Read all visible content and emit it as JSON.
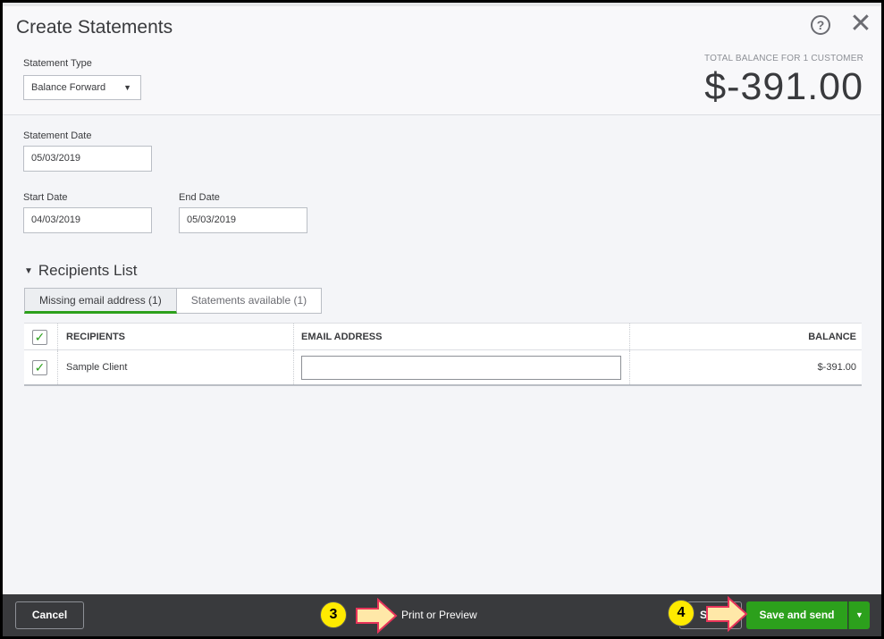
{
  "dialog": {
    "title": "Create Statements"
  },
  "statement_type": {
    "label": "Statement Type",
    "selected": "Balance Forward"
  },
  "total": {
    "label": "TOTAL BALANCE FOR 1 CUSTOMER",
    "value": "$-391.00"
  },
  "statement_date": {
    "label": "Statement Date",
    "value": "05/03/2019"
  },
  "start_date": {
    "label": "Start Date",
    "value": "04/03/2019"
  },
  "end_date": {
    "label": "End Date",
    "value": "05/03/2019"
  },
  "recipients": {
    "section_title": "Recipients List",
    "tabs": [
      {
        "label": "Missing email address (1)",
        "active": true
      },
      {
        "label": "Statements available (1)",
        "active": false
      }
    ],
    "columns": [
      "RECIPIENTS",
      "EMAIL ADDRESS",
      "BALANCE"
    ],
    "rows": [
      {
        "name": "Sample Client",
        "email": "",
        "balance": "$-391.00",
        "checked": true
      }
    ]
  },
  "footer": {
    "cancel_label": "Cancel",
    "print_label": "Print or Preview",
    "save_label": "Save",
    "save_send_label": "Save and send"
  },
  "annotations": {
    "step3": "3",
    "step4": "4"
  },
  "colors": {
    "accent_green": "#2ca01c",
    "footer_bg": "#393a3d",
    "badge_yellow": "#ffea00",
    "arrow_fill": "#ffe8a8",
    "arrow_stroke": "#e8345a"
  },
  "icons": {
    "help": "help-icon",
    "close": "close-icon",
    "checkbox": "checkmark-icon",
    "caret": "chevron-down-icon"
  }
}
